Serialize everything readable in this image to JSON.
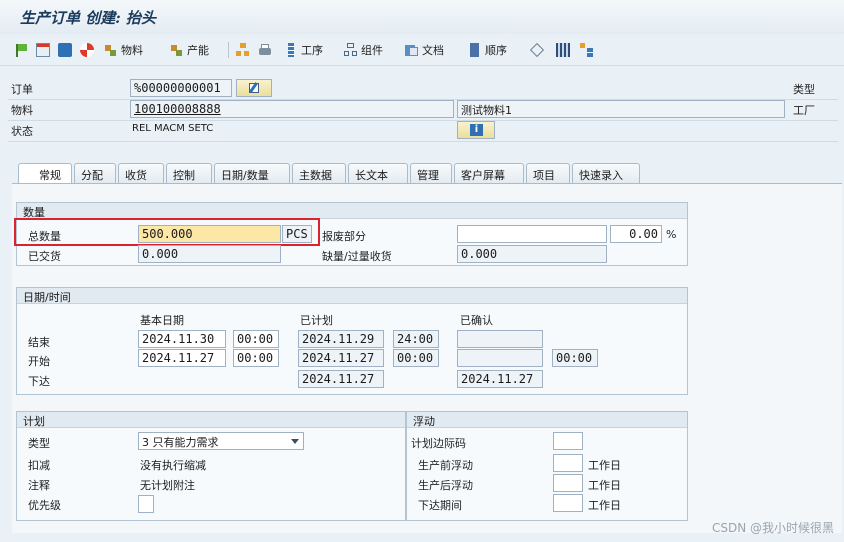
{
  "title": "生产订单 创建: 抬头",
  "toolbar": {
    "material": "物料",
    "capacity": "产能",
    "operations": "工序",
    "components": "组件",
    "documents": "文档",
    "sequence": "顺序"
  },
  "header": {
    "order_label": "订单",
    "order_value": "%00000000001",
    "material_label": "物料",
    "material_value": "100100008888",
    "material_desc": "测试物料1",
    "status_label": "状态",
    "status_value": "REL  MACM SETC",
    "type_label": "类型",
    "plant_label": "工厂"
  },
  "tabs": [
    "常规",
    "分配",
    "收货",
    "控制",
    "日期/数量",
    "主数据",
    "长文本",
    "管理",
    "客户屏幕",
    "项目",
    "快速录入"
  ],
  "quantity": {
    "group_title": "数量",
    "total_label": "总数量",
    "total_value": "500.000",
    "unit": "PCS",
    "scrap_label": "报废部分",
    "scrap_value": "",
    "scrap_pct": "0.00",
    "pct_sign": "%",
    "delivered_label": "已交货",
    "delivered_value": "0.000",
    "short_label": "缺量/过量收货",
    "short_value": "0.000"
  },
  "dates": {
    "group_title": "日期/时间",
    "col_basic": "基本日期",
    "col_scheduled": "已计划",
    "col_confirmed": "已确认",
    "end_label": "结束",
    "end_basic_date": "2024.11.30",
    "end_basic_time": "00:00",
    "end_sched_date": "2024.11.29",
    "end_sched_time": "24:00",
    "end_conf_date": "",
    "start_label": "开始",
    "start_basic_date": "2024.11.27",
    "start_basic_time": "00:00",
    "start_sched_date": "2024.11.27",
    "start_sched_time": "00:00",
    "start_conf_date": "",
    "start_conf_time": "00:00",
    "release_label": "下达",
    "release_sched_date": "2024.11.27",
    "release_conf_date": "2024.11.27"
  },
  "planning": {
    "group_title": "计划",
    "type_label": "类型",
    "type_value": "3 只有能力需求",
    "reduction_label": "扣减",
    "reduction_value": "没有执行缩减",
    "note_label": "注释",
    "note_value": "无计划附注",
    "priority_label": "优先级",
    "priority_value": ""
  },
  "float": {
    "group_title": "浮动",
    "sched_margin_label": "计划边际码",
    "float_before_label": "生产前浮动",
    "float_after_label": "生产后浮动",
    "release_period_label": "下达期间",
    "unit_workdays": "工作日"
  },
  "watermark": "CSDN @我小时候很黑",
  "colors": {
    "highlight": "#d9232e",
    "active_field": "#fde7a6"
  }
}
